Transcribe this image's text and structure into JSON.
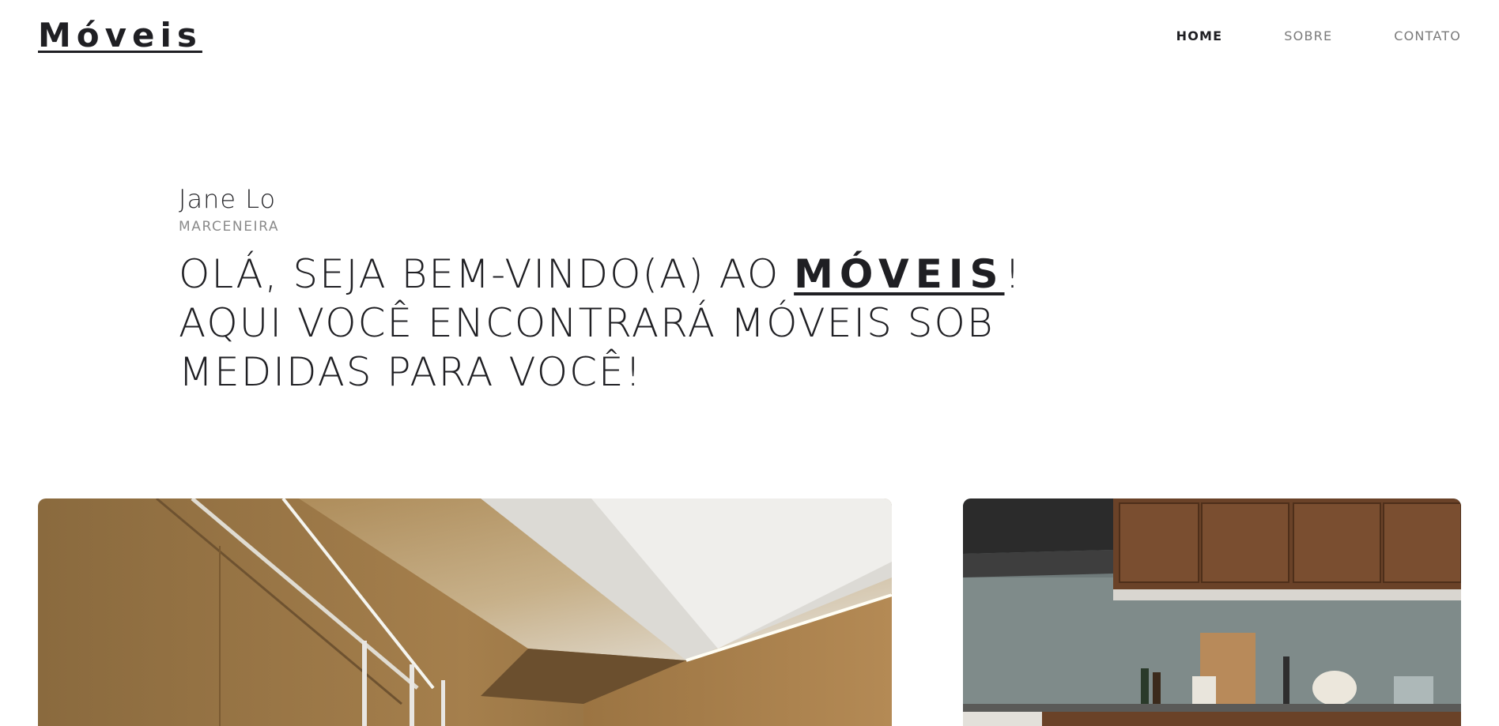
{
  "header": {
    "logo": "Móveis",
    "nav": [
      {
        "label": "HOME",
        "active": true
      },
      {
        "label": "SOBRE",
        "active": false
      },
      {
        "label": "CONTATO",
        "active": false
      }
    ]
  },
  "intro": {
    "name": "Jane Lo",
    "role": "MARCENEIRA",
    "headline_prefix": "OLÁ, SEJA BEM-VINDO(A) AO ",
    "headline_brand": "MÓVEIS",
    "headline_suffix": "! AQUI VOCÊ ENCONTRARÁ MÓVEIS SOB MEDIDAS PARA VOCÊ!"
  },
  "gallery": {
    "items": [
      {
        "image": "wood-paneled-corridor-photo"
      },
      {
        "image": "kitchen-cabinets-photo"
      }
    ]
  },
  "colors": {
    "text": "#1f1f23",
    "muted": "#7a7a7a",
    "background": "#ffffff"
  }
}
